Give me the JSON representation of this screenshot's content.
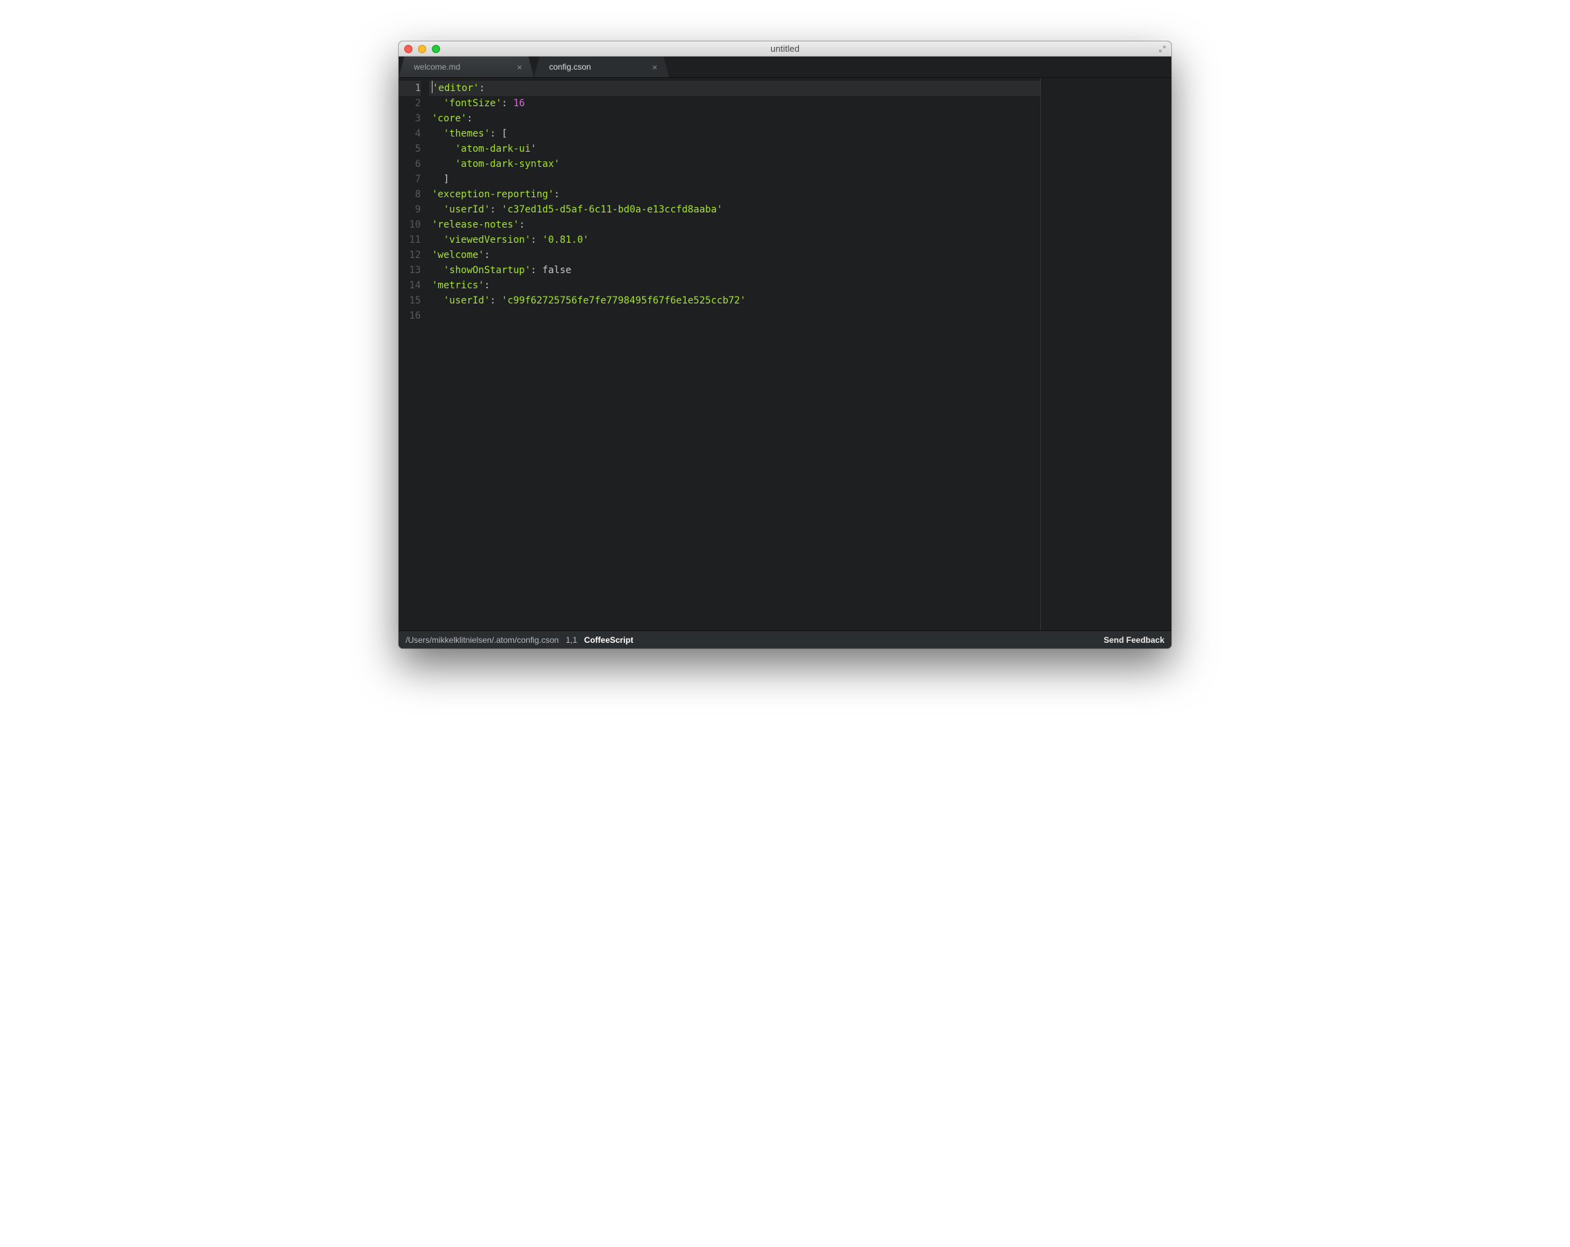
{
  "window": {
    "title": "untitled"
  },
  "tabs": [
    {
      "label": "welcome.md",
      "active": false
    },
    {
      "label": "config.cson",
      "active": true
    }
  ],
  "editor": {
    "line_count": 16,
    "current_line": 1,
    "tokens": [
      [
        {
          "t": "cursor"
        },
        {
          "t": "str",
          "v": "'editor'"
        },
        {
          "t": "p",
          "v": ":"
        }
      ],
      [
        {
          "t": "p",
          "v": "  "
        },
        {
          "t": "str",
          "v": "'fontSize'"
        },
        {
          "t": "p",
          "v": ": "
        },
        {
          "t": "num",
          "v": "16"
        }
      ],
      [
        {
          "t": "str",
          "v": "'core'"
        },
        {
          "t": "p",
          "v": ":"
        }
      ],
      [
        {
          "t": "p",
          "v": "  "
        },
        {
          "t": "str",
          "v": "'themes'"
        },
        {
          "t": "p",
          "v": ": ["
        }
      ],
      [
        {
          "t": "p",
          "v": "    "
        },
        {
          "t": "str",
          "v": "'atom-dark-ui'"
        }
      ],
      [
        {
          "t": "p",
          "v": "    "
        },
        {
          "t": "str",
          "v": "'atom-dark-syntax'"
        }
      ],
      [
        {
          "t": "p",
          "v": "  ]"
        }
      ],
      [
        {
          "t": "str",
          "v": "'exception-reporting'"
        },
        {
          "t": "p",
          "v": ":"
        }
      ],
      [
        {
          "t": "p",
          "v": "  "
        },
        {
          "t": "str",
          "v": "'userId'"
        },
        {
          "t": "p",
          "v": ": "
        },
        {
          "t": "str",
          "v": "'c37ed1d5-d5af-6c11-bd0a-e13ccfd8aaba'"
        }
      ],
      [
        {
          "t": "str",
          "v": "'release-notes'"
        },
        {
          "t": "p",
          "v": ":"
        }
      ],
      [
        {
          "t": "p",
          "v": "  "
        },
        {
          "t": "str",
          "v": "'viewedVersion'"
        },
        {
          "t": "p",
          "v": ": "
        },
        {
          "t": "str",
          "v": "'0.81.0'"
        }
      ],
      [
        {
          "t": "str",
          "v": "'welcome'"
        },
        {
          "t": "p",
          "v": ":"
        }
      ],
      [
        {
          "t": "p",
          "v": "  "
        },
        {
          "t": "str",
          "v": "'showOnStartup'"
        },
        {
          "t": "p",
          "v": ": "
        },
        {
          "t": "bool",
          "v": "false"
        }
      ],
      [
        {
          "t": "str",
          "v": "'metrics'"
        },
        {
          "t": "p",
          "v": ":"
        }
      ],
      [
        {
          "t": "p",
          "v": "  "
        },
        {
          "t": "str",
          "v": "'userId'"
        },
        {
          "t": "p",
          "v": ": "
        },
        {
          "t": "str",
          "v": "'c99f62725756fe7fe7798495f67f6e1e525ccb72'"
        }
      ],
      []
    ]
  },
  "status": {
    "path": "/Users/mikkelklitnielsen/.atom/config.cson",
    "position": "1,1",
    "language": "CoffeeScript",
    "feedback": "Send Feedback"
  }
}
